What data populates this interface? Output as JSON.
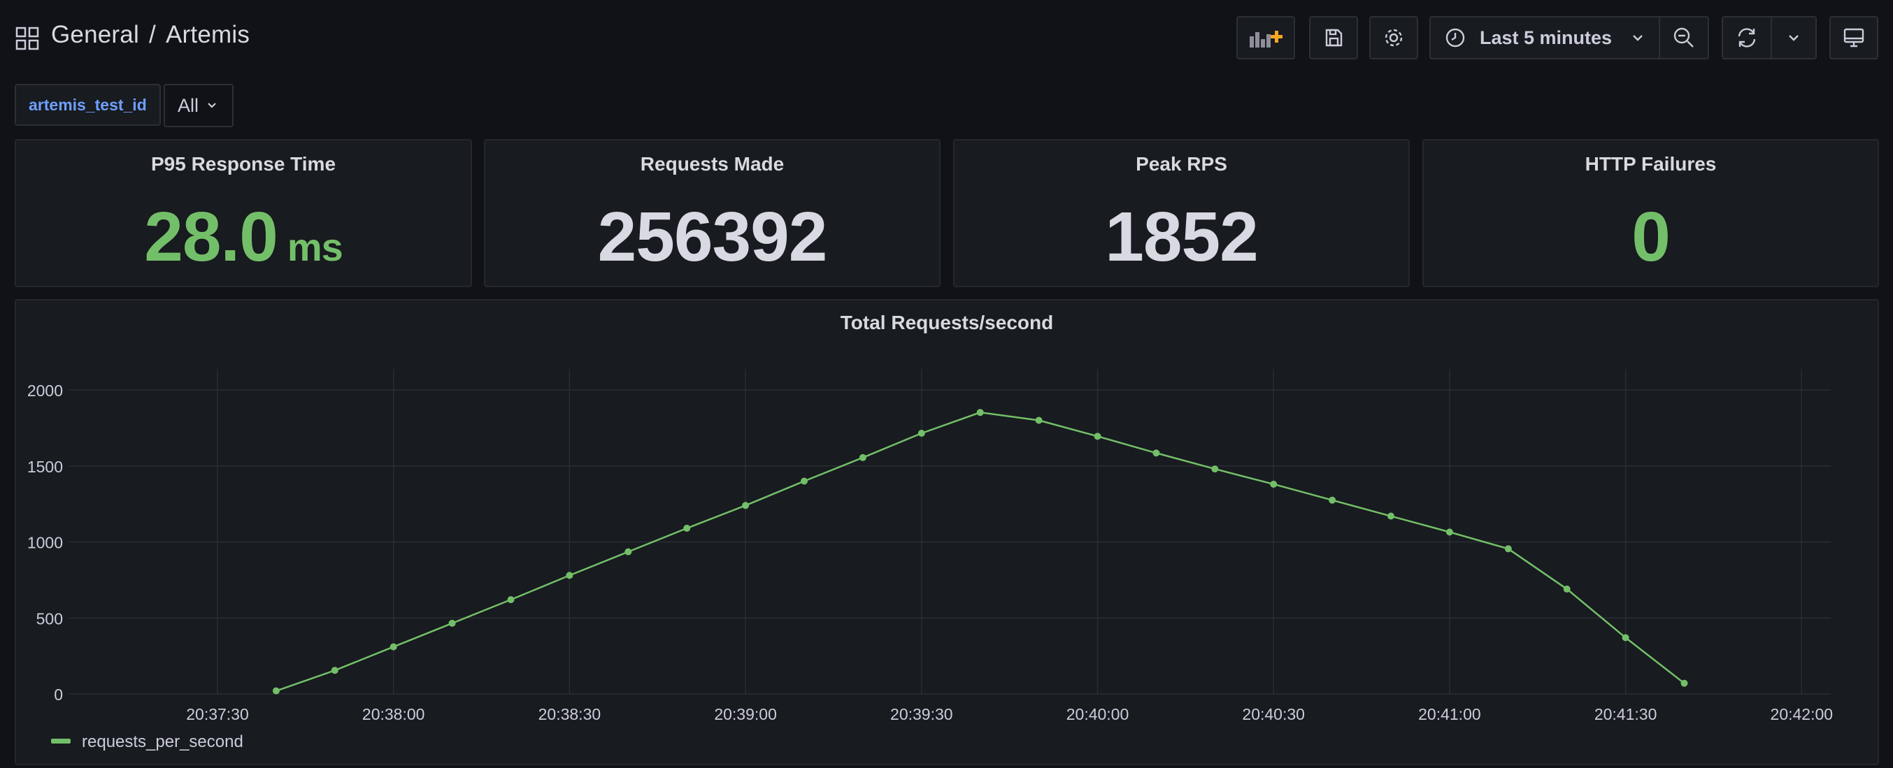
{
  "header": {
    "folder": "General",
    "separator": "/",
    "dashboard": "Artemis",
    "time_range": "Last 5 minutes"
  },
  "variable": {
    "label": "artemis_test_id",
    "value": "All"
  },
  "stats": [
    {
      "title": "P95 Response Time",
      "value": "28.0",
      "unit": "ms",
      "color": "#73bf69"
    },
    {
      "title": "Requests Made",
      "value": "256392",
      "unit": "",
      "color": "#d8d9e2"
    },
    {
      "title": "Peak RPS",
      "value": "1852",
      "unit": "",
      "color": "#d8d9e2"
    },
    {
      "title": "HTTP Failures",
      "value": "0",
      "unit": "",
      "color": "#73bf69"
    }
  ],
  "chart": {
    "title": "Total Requests/second",
    "legend": "requests_per_second"
  },
  "chart_data": {
    "type": "line",
    "title": "Total Requests/second",
    "xlabel": "",
    "ylabel": "",
    "x_ticks": [
      "20:37:30",
      "20:38:00",
      "20:38:30",
      "20:39:00",
      "20:39:30",
      "20:40:00",
      "20:40:30",
      "20:41:00",
      "20:41:30",
      "20:42:00"
    ],
    "y_ticks": [
      "0",
      "500",
      "1000",
      "1500",
      "2000"
    ],
    "ylim": [
      0,
      2000
    ],
    "legend_position": "bottom-left",
    "grid": true,
    "series": [
      {
        "name": "requests_per_second",
        "color": "#73bf69",
        "x": [
          "20:37:40",
          "20:37:50",
          "20:38:00",
          "20:38:10",
          "20:38:20",
          "20:38:30",
          "20:38:40",
          "20:38:50",
          "20:39:00",
          "20:39:10",
          "20:39:20",
          "20:39:30",
          "20:39:40",
          "20:39:50",
          "20:40:00",
          "20:40:10",
          "20:40:20",
          "20:40:30",
          "20:40:40",
          "20:40:50",
          "20:41:00",
          "20:41:10",
          "20:41:20",
          "20:41:30",
          "20:41:40"
        ],
        "values": [
          20,
          155,
          310,
          465,
          620,
          780,
          935,
          1090,
          1240,
          1400,
          1555,
          1715,
          1852,
          1800,
          1695,
          1585,
          1480,
          1380,
          1275,
          1170,
          1065,
          955,
          690,
          370,
          70
        ]
      }
    ]
  }
}
